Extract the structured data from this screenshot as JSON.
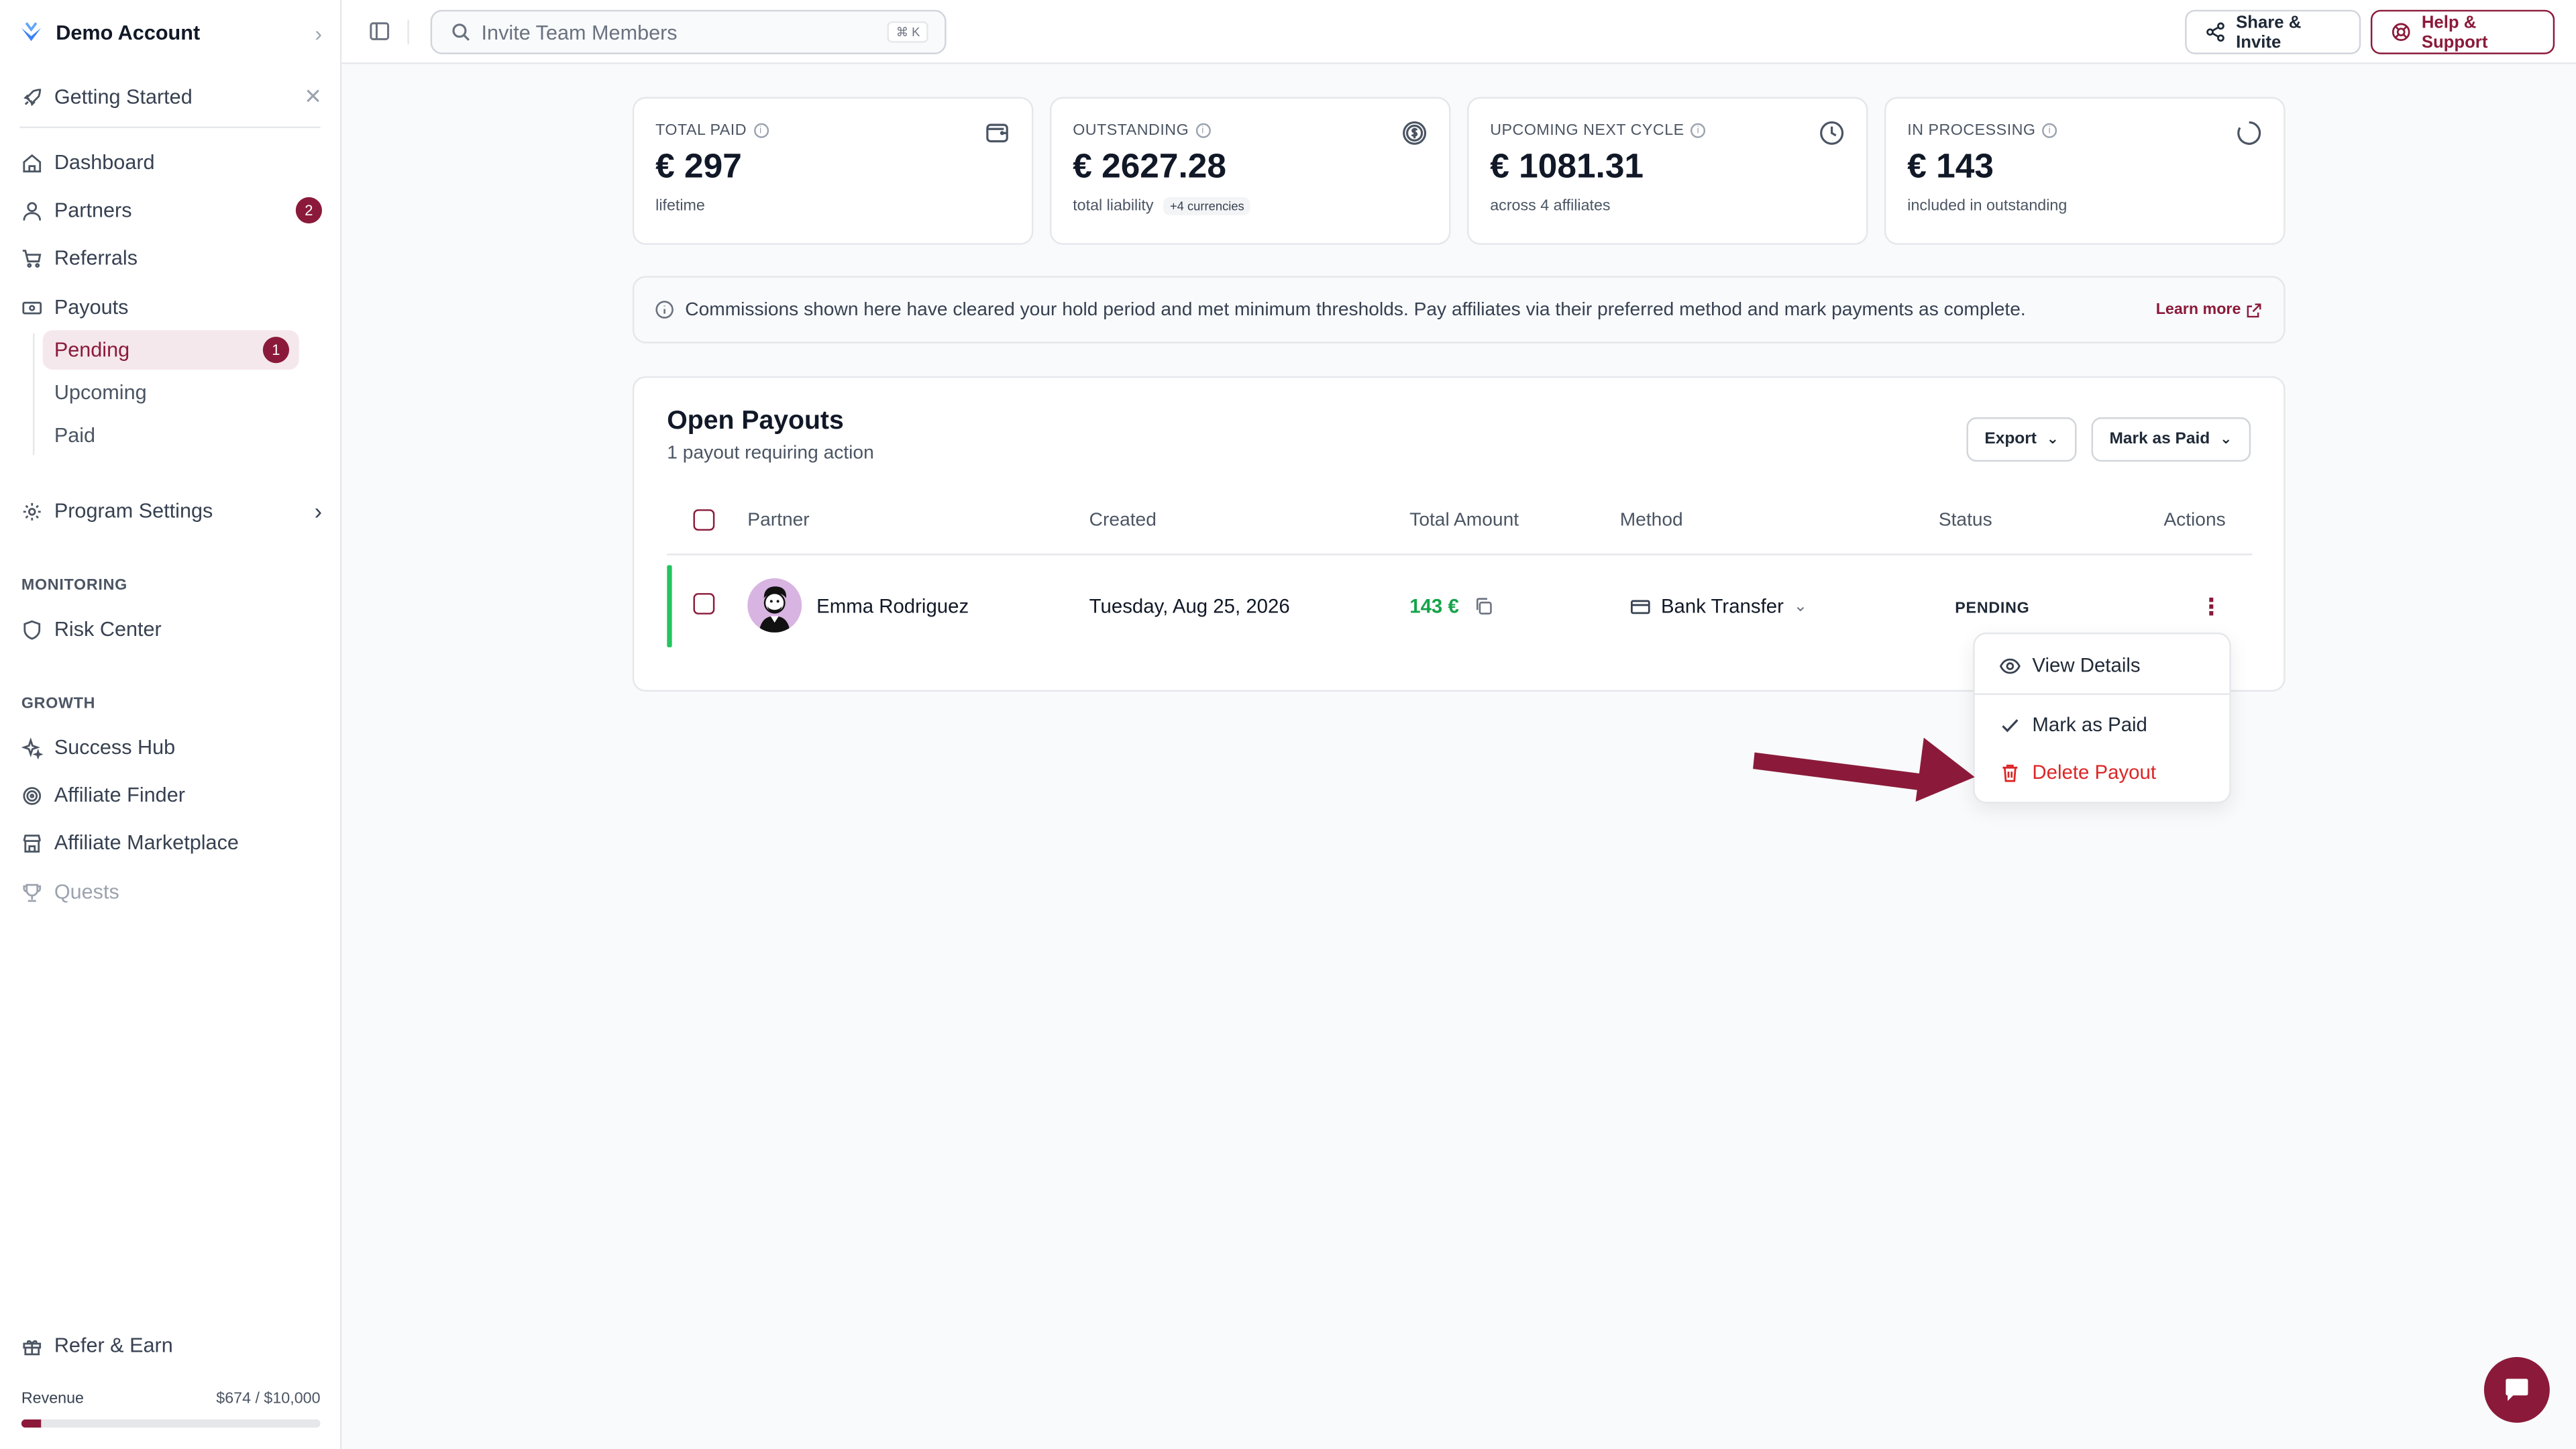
{
  "sidebar": {
    "account_name": "Demo Account",
    "getting_started": "Getting Started",
    "items": {
      "dashboard": "Dashboard",
      "partners": "Partners",
      "partners_badge": "2",
      "referrals": "Referrals",
      "payouts": "Payouts",
      "pending": "Pending",
      "pending_badge": "1",
      "upcoming": "Upcoming",
      "paid": "Paid",
      "program_settings": "Program Settings"
    },
    "monitoring_label": "MONITORING",
    "risk_center": "Risk Center",
    "growth_label": "GROWTH",
    "success_hub": "Success Hub",
    "affiliate_finder": "Affiliate Finder",
    "affiliate_marketplace": "Affiliate Marketplace",
    "quests": "Quests",
    "refer_earn": "Refer & Earn",
    "revenue_label": "Revenue",
    "revenue_value": "$674 / $10,000",
    "revenue_progress": 0.0674
  },
  "topbar": {
    "search_placeholder": "Invite Team Members",
    "search_shortcut": "⌘ K",
    "share_label": "Share & Invite",
    "help_label": "Help & Support"
  },
  "stats": [
    {
      "label": "TOTAL PAID",
      "value": "€ 297",
      "sub": "lifetime",
      "icon": "wallet-icon"
    },
    {
      "label": "OUTSTANDING",
      "value": "€ 2627.28",
      "sub": "total liability",
      "pill": "+4 currencies",
      "icon": "dollar-circle-icon"
    },
    {
      "label": "UPCOMING NEXT CYCLE",
      "value": "€ 1081.31",
      "sub": "across 4 affiliates",
      "icon": "clock-icon"
    },
    {
      "label": "IN PROCESSING",
      "value": "€ 143",
      "sub": "included in outstanding",
      "icon": "loader-icon"
    }
  ],
  "banner": {
    "text": "Commissions shown here have cleared your hold period and met minimum thresholds. Pay affiliates via their preferred method and mark payments as complete.",
    "link": "Learn more"
  },
  "payouts": {
    "title": "Open Payouts",
    "subtitle": "1 payout requiring action",
    "export_label": "Export",
    "mark_paid_label": "Mark as Paid",
    "columns": [
      "Partner",
      "Created",
      "Total Amount",
      "Method",
      "Status",
      "Actions"
    ],
    "rows": [
      {
        "partner": "Emma Rodriguez",
        "created": "Tuesday, Aug 25, 2026",
        "amount": "143 €",
        "method": "Bank Transfer",
        "status": "PENDING"
      }
    ]
  },
  "menu": {
    "view_details": "View Details",
    "mark_as_paid": "Mark as Paid",
    "delete_payout": "Delete Payout"
  },
  "colors": {
    "brand": "#8b1a3a",
    "success": "#16a34a",
    "danger": "#dc2626"
  }
}
